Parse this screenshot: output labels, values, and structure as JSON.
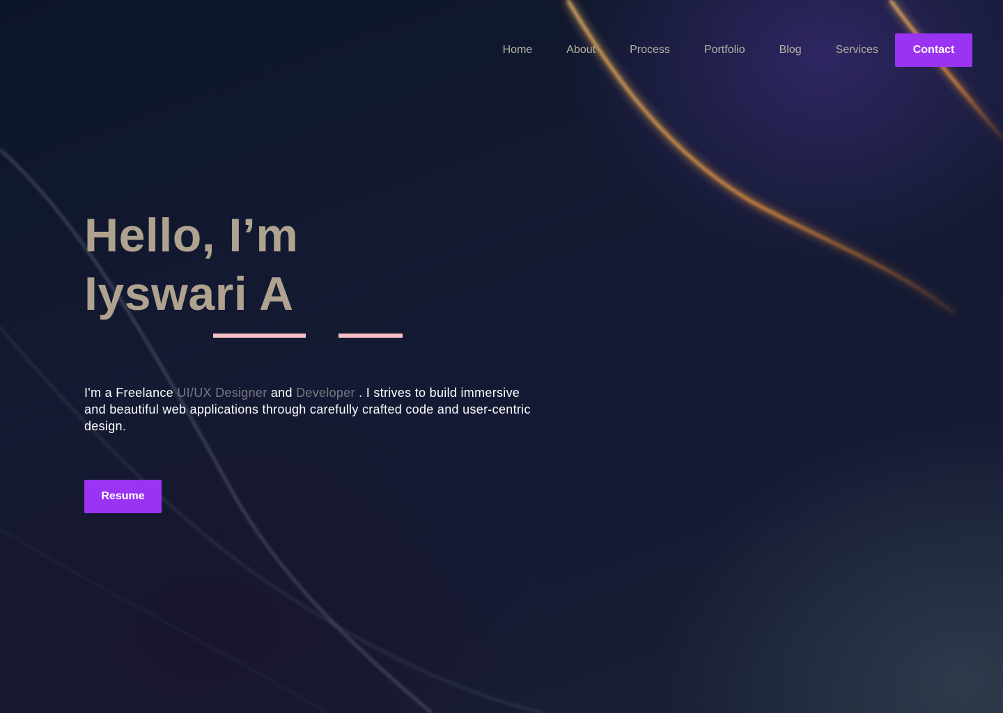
{
  "nav": {
    "links": [
      "Home",
      "About",
      "Process",
      "Portfolio",
      "Blog",
      "Services"
    ],
    "contact_label": "Contact"
  },
  "hero": {
    "greeting": "Hello, I’m",
    "name": "Iyswari A",
    "intro": {
      "prefix": "I'm a Freelance ",
      "role1": "UI/UX Designer",
      "conj": " and ",
      "role2": "Developer",
      "suffix": " . I strives to build immersive and beautiful web applications through carefully crafted code and user-centric design."
    },
    "resume_label": "Resume"
  },
  "colors": {
    "accent": "#9b33f2",
    "title": "#afa390",
    "underline": "#f6c2c6",
    "highlight_text": "#7b7784"
  }
}
